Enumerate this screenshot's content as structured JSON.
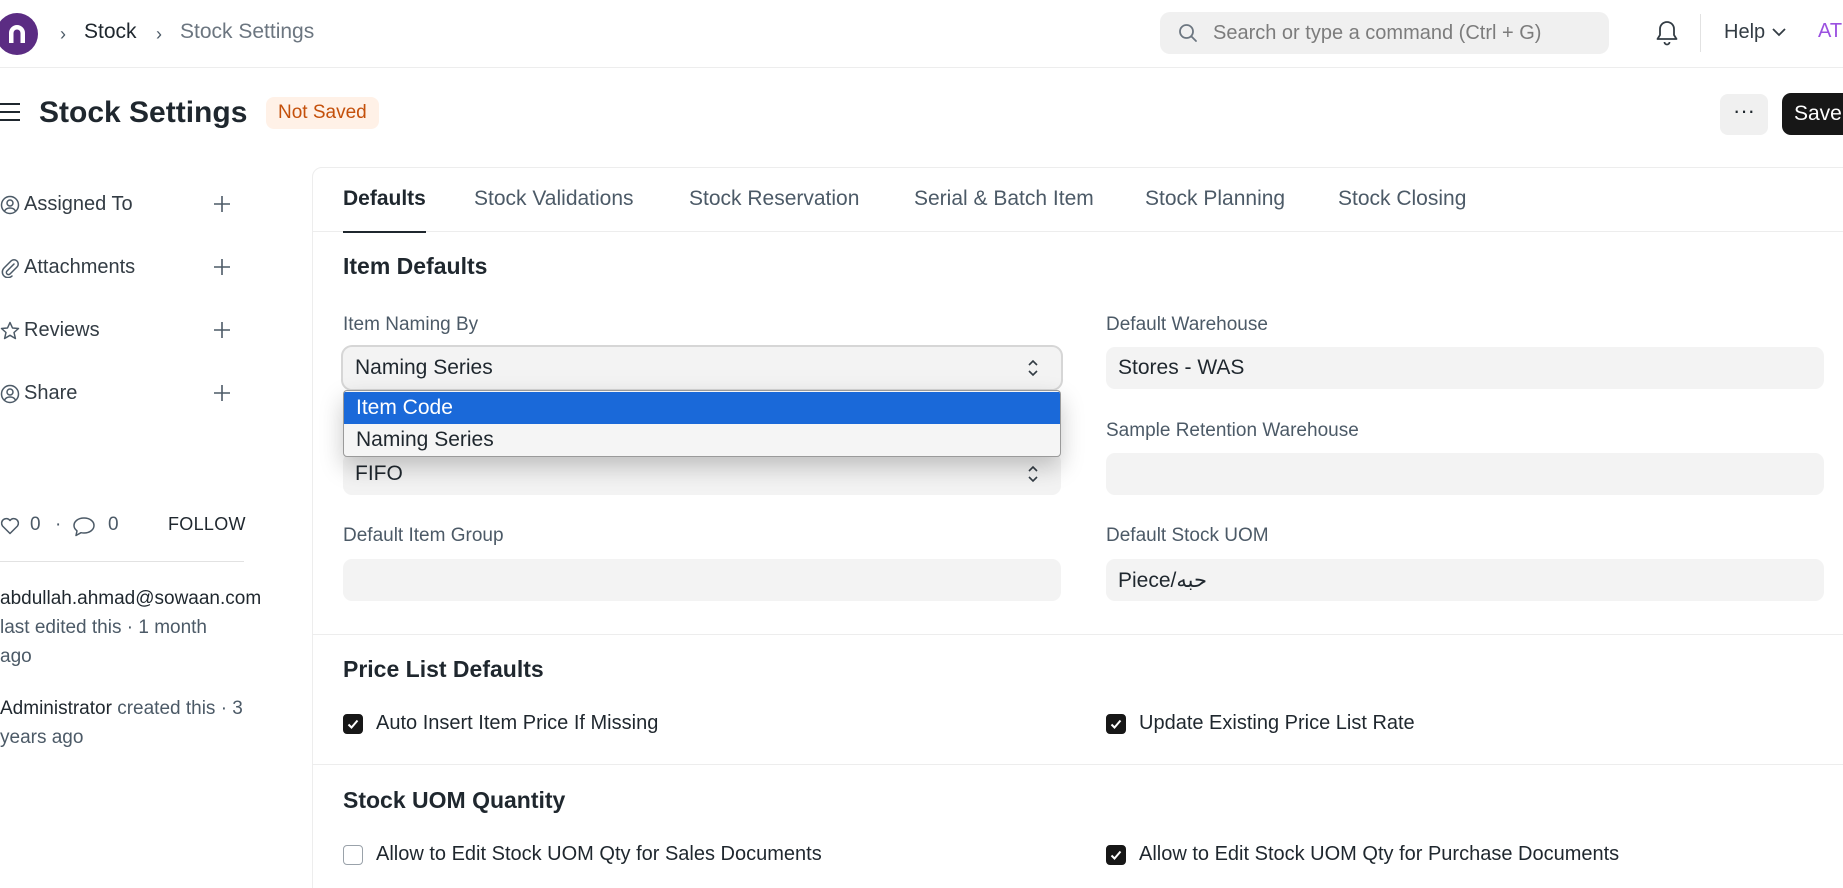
{
  "breadcrumb": {
    "items": [
      "Stock",
      "Stock Settings"
    ]
  },
  "search": {
    "placeholder": "Search or type a command (Ctrl + G)"
  },
  "navbar": {
    "help_label": "Help",
    "avatar_initials": "AT"
  },
  "page": {
    "title": "Stock Settings",
    "status_badge": "Not Saved",
    "more_label": "···",
    "save_label": "Save"
  },
  "sidebar": {
    "items": [
      {
        "label": "Assigned To",
        "icon": "user-icon"
      },
      {
        "label": "Attachments",
        "icon": "paperclip-icon"
      },
      {
        "label": "Reviews",
        "icon": "star-icon"
      },
      {
        "label": "Share",
        "icon": "share-user-icon"
      }
    ],
    "likes_count": "0",
    "comments_count": "0",
    "follow_label": "FOLLOW",
    "activity": [
      {
        "who": "abdullah.ahmad@sowaan.com",
        "text": "last edited this · 1 month ago"
      },
      {
        "who": "Administrator",
        "text": " created this · 3 years ago"
      }
    ]
  },
  "tabs": [
    "Defaults",
    "Stock Validations",
    "Stock Reservation",
    "Serial & Batch Item",
    "Stock Planning",
    "Stock Closing"
  ],
  "active_tab": "Defaults",
  "sections": {
    "item_defaults": {
      "title": "Item Defaults",
      "item_naming_by": {
        "label": "Item Naming By",
        "value": "Naming Series",
        "options": [
          "Item Code",
          "Naming Series"
        ],
        "highlighted_option": "Item Code"
      },
      "valuation_method": {
        "value": "FIFO"
      },
      "default_item_group": {
        "label": "Default Item Group",
        "value": ""
      },
      "default_warehouse": {
        "label": "Default Warehouse",
        "value": "Stores - WAS"
      },
      "sample_retention_warehouse": {
        "label": "Sample Retention Warehouse",
        "value": ""
      },
      "default_stock_uom": {
        "label": "Default Stock UOM",
        "value": "Piece/حبه"
      }
    },
    "price_list_defaults": {
      "title": "Price List Defaults",
      "auto_insert": {
        "label": "Auto Insert Item Price If Missing",
        "checked": true
      },
      "update_existing": {
        "label": "Update Existing Price List Rate",
        "checked": true
      }
    },
    "stock_uom_quantity": {
      "title": "Stock UOM Quantity",
      "sales_docs": {
        "label": "Allow to Edit Stock UOM Qty for Sales Documents",
        "checked": false
      },
      "purchase_docs": {
        "label": "Allow to Edit Stock UOM Qty for Purchase Documents",
        "checked": true
      }
    }
  },
  "colors": {
    "brand": "#5b2c83",
    "badge_bg": "#fff1e7",
    "badge_text": "#c4500b",
    "dropdown_highlight": "#1a69d9",
    "primary_button": "#171717"
  }
}
